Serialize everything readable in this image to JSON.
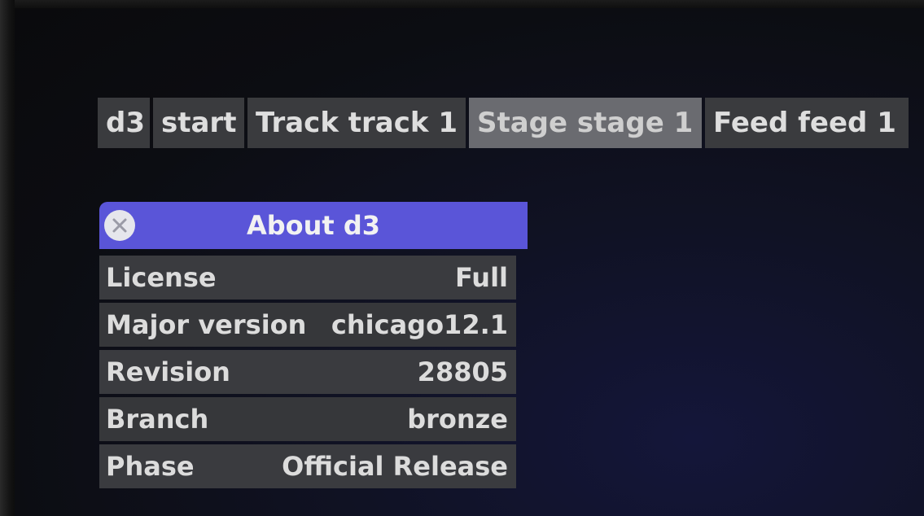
{
  "tabs": [
    {
      "label": "d3",
      "active": false
    },
    {
      "label": "start",
      "active": false
    },
    {
      "label": "Track track 1",
      "active": false
    },
    {
      "label": "Stage stage 1",
      "active": true
    },
    {
      "label": "Feed feed 1",
      "active": false
    }
  ],
  "about_dialog": {
    "title": "About d3",
    "header_color": "#5a55d8",
    "close_icon": "close-icon",
    "rows": [
      {
        "label": "License",
        "value": "Full"
      },
      {
        "label": "Major version",
        "value": "chicago12.1"
      },
      {
        "label": "Revision",
        "value": "28805"
      },
      {
        "label": "Branch",
        "value": "bronze"
      },
      {
        "label": "Phase",
        "value": "Official Release"
      }
    ]
  }
}
